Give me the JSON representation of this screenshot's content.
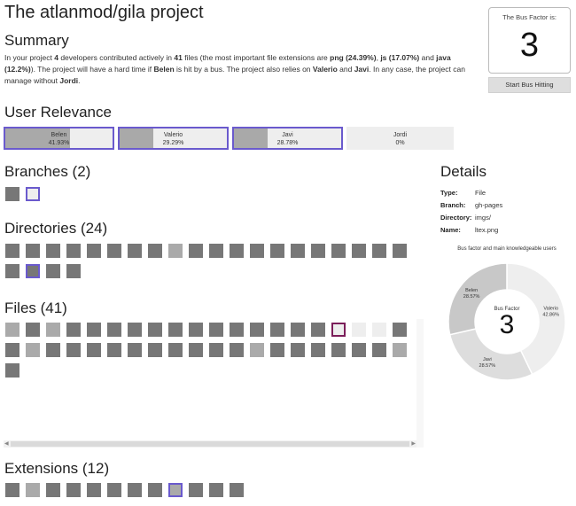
{
  "title": "The atlanmod/gila project",
  "summary": {
    "heading": "Summary",
    "p1": "In your project ",
    "dev_count": "4",
    "p2": " developers contributed actively in ",
    "file_count": "41",
    "p3": " files (the most important file extensions are ",
    "ext1": "png (24.39%)",
    "p4": ", ",
    "ext2": "js (17.07%)",
    "p5": " and ",
    "ext3": "java (12.2%)",
    "p6": "). The project will have a hard time if ",
    "critical": "Belen",
    "p7": " is hit by a bus. The project also relies on ",
    "relies1": "Valerio",
    "p8": " and ",
    "relies2": "Javi",
    "p9": ". In any case, the project can manage without ",
    "without": "Jordi",
    "p10": "."
  },
  "bus_factor": {
    "label": "The Bus Factor is:",
    "value": "3",
    "button": "Start Bus Hitting"
  },
  "user_relevance": {
    "heading": "User Relevance",
    "users": [
      {
        "name": "Belen",
        "percent": "41.93%",
        "fill": 0.6,
        "highlighted": true
      },
      {
        "name": "Valerio",
        "percent": "29.29%",
        "fill": 0.31,
        "highlighted": true
      },
      {
        "name": "Javi",
        "percent": "28.78%",
        "fill": 0.31,
        "highlighted": true
      },
      {
        "name": "Jordi",
        "percent": "0%",
        "fill": 0.0,
        "highlighted": false
      }
    ]
  },
  "branches": {
    "heading": "Branches (2)"
  },
  "directories": {
    "heading": "Directories (24)"
  },
  "files": {
    "heading": "Files (41)"
  },
  "extensions": {
    "heading": "Extensions (12)"
  },
  "details": {
    "heading": "Details",
    "rows": [
      {
        "key": "Type:",
        "value": "File"
      },
      {
        "key": "Branch:",
        "value": "gh-pages"
      },
      {
        "key": "Directory:",
        "value": "imgs/"
      },
      {
        "key": "Name:",
        "value": "ltex.png"
      }
    ]
  },
  "donut": {
    "title": "Bus factor and main knowledgeable users",
    "center_label": "Bus Factor",
    "center_value": "3",
    "segments": [
      {
        "name": "Valerio",
        "percent": "42.86%",
        "value": 42.86,
        "color": "#eeeeee"
      },
      {
        "name": "Javi",
        "percent": "28.57%",
        "value": 28.57,
        "color": "#dddddd"
      },
      {
        "name": "Belen",
        "percent": "28.57%",
        "value": 28.57,
        "color": "#c8c8c8"
      }
    ]
  },
  "colors": {
    "accent": "#6a5acd",
    "square_dark": "#777777",
    "square_light": "#aaaaaa",
    "selected_file": "#7b1e5a"
  }
}
